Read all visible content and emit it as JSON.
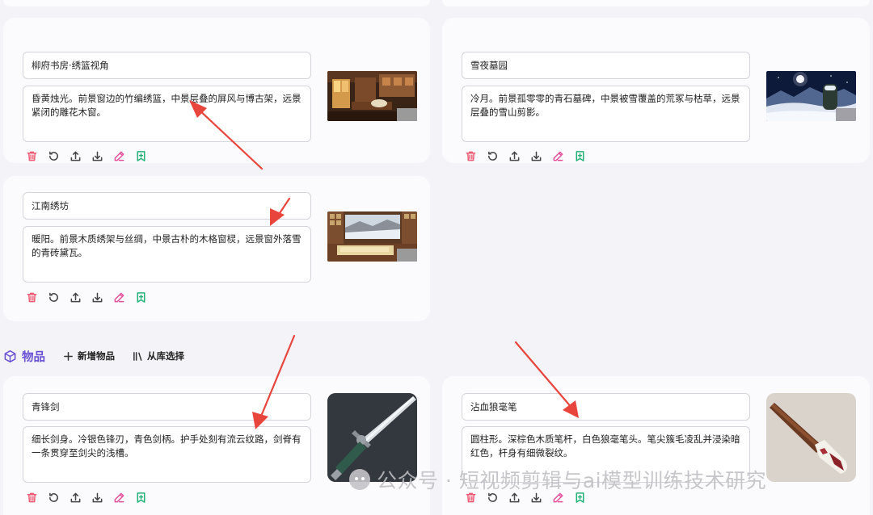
{
  "cards": [
    {
      "name": "柳府书房·绣篮视角",
      "description": "昏黄烛光。前景窗边的竹编绣篮，中景层叠的屏风与博古架，远景紧闭的雕花木窗。",
      "thumb_icon": "study-room-thumbnail"
    },
    {
      "name": "雪夜墓园",
      "description": "冷月。前景孤零零的青石墓碑，中景被雪覆盖的荒冢与枯草，远景层叠的雪山剪影。",
      "thumb_icon": "snow-graveyard-thumbnail"
    },
    {
      "name": "江南绣坊",
      "description": "暖阳。前景木质绣架与丝绸，中景古朴的木格窗棂，远景窗外落雪的青砖黛瓦。",
      "thumb_icon": "embroidery-workshop-thumbnail"
    }
  ],
  "items_section": {
    "title": "物品",
    "add_label": "新增物品",
    "library_label": "从库选择",
    "items": [
      {
        "name": "青锋剑",
        "description": "细长剑身。冷银色锋刃，青色剑柄。护手处刻有流云纹路，剑脊有一条贯穿至剑尖的浅槽。",
        "thumb_icon": "sword-thumbnail"
      },
      {
        "name": "沾血狼毫笔",
        "description": "圆柱形。深棕色木质笔杆，白色狼毫笔头。笔尖簇毛凌乱并浸染暗红色，杆身有细微裂纹。",
        "thumb_icon": "brush-thumbnail"
      }
    ]
  },
  "action_icons": [
    "trash-icon",
    "refresh-icon",
    "upload-icon",
    "download-icon",
    "edit-icon",
    "bookmark-plus-icon"
  ],
  "colors": {
    "accent": "#6a50d2",
    "delete": "#ef5a73",
    "edit": "#e44e9a",
    "save": "#23b275",
    "annotation_arrow": "#e8453c"
  },
  "watermark": "公众号 · 短视频剪辑与ai模型训练技术研究"
}
